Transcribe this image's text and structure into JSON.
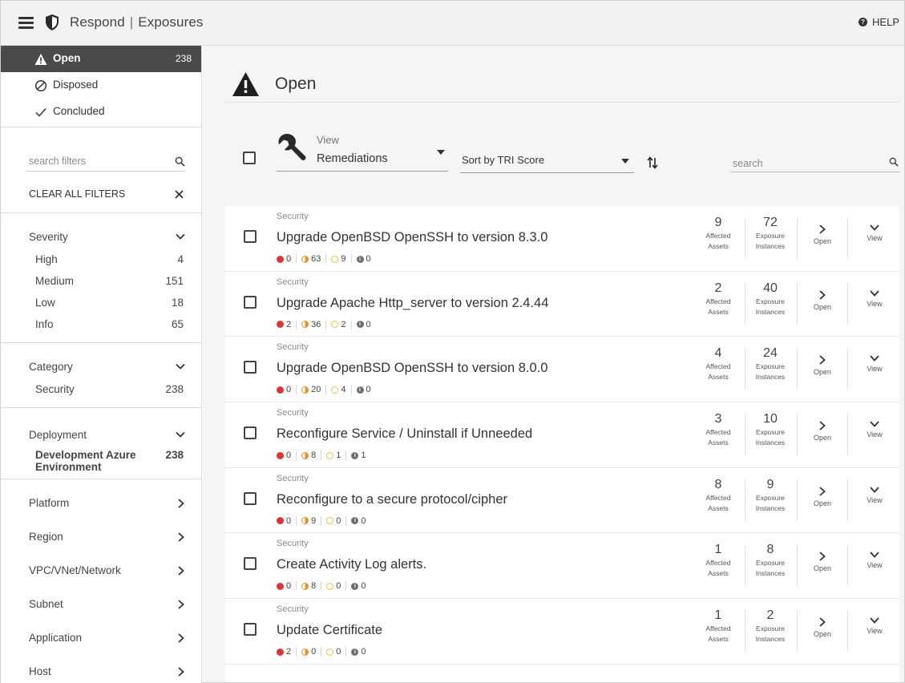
{
  "header": {
    "section": "Respond",
    "separator": "|",
    "page": "Exposures",
    "help_label": "HELP"
  },
  "sidebar": {
    "statuses": [
      {
        "label": "Open",
        "count": "238",
        "icon": "warning-icon",
        "active": true
      },
      {
        "label": "Disposed",
        "count": "",
        "icon": "disposed-icon",
        "active": false
      },
      {
        "label": "Concluded",
        "count": "",
        "icon": "check-icon",
        "active": false
      }
    ],
    "search_placeholder": "search filters",
    "clear_all_label": "CLEAR ALL FILTERS",
    "severity": {
      "label": "Severity",
      "items": [
        {
          "label": "High",
          "count": "4"
        },
        {
          "label": "Medium",
          "count": "151"
        },
        {
          "label": "Low",
          "count": "18"
        },
        {
          "label": "Info",
          "count": "65"
        }
      ]
    },
    "category": {
      "label": "Category",
      "items": [
        {
          "label": "Security",
          "count": "238"
        }
      ]
    },
    "deployment": {
      "label": "Deployment",
      "items": [
        {
          "label": "Development Azure Environment",
          "count": "238"
        }
      ]
    },
    "collapsed_facets": [
      "Platform",
      "Region",
      "VPC/VNet/Network",
      "Subnet",
      "Application",
      "Host"
    ]
  },
  "main": {
    "title": "Open",
    "view_label": "View",
    "view_value": "Remediations",
    "sort_value": "Sort by TRI Score",
    "search_placeholder": "search",
    "affected_label_1": "Affected",
    "affected_label_2": "Assets",
    "exposure_label_1": "Exposure",
    "exposure_label_2": "Instances",
    "open_label": "Open",
    "view_action_label": "View",
    "rows": [
      {
        "category": "Security",
        "title": "Upgrade OpenBSD OpenSSH to version 8.3.0",
        "critical": "0",
        "medium": "63",
        "low": "9",
        "info": "0",
        "assets": "9",
        "instances": "72"
      },
      {
        "category": "Security",
        "title": "Upgrade Apache Http_server to version 2.4.44",
        "critical": "2",
        "medium": "36",
        "low": "2",
        "info": "0",
        "assets": "2",
        "instances": "40"
      },
      {
        "category": "Security",
        "title": "Upgrade OpenBSD OpenSSH to version 8.0.0",
        "critical": "0",
        "medium": "20",
        "low": "4",
        "info": "0",
        "assets": "4",
        "instances": "24"
      },
      {
        "category": "Security",
        "title": "Reconfigure Service / Uninstall if Unneeded",
        "critical": "0",
        "medium": "8",
        "low": "1",
        "info": "1",
        "assets": "3",
        "instances": "10"
      },
      {
        "category": "Security",
        "title": "Reconfigure to a secure protocol/cipher",
        "critical": "0",
        "medium": "9",
        "low": "0",
        "info": "0",
        "assets": "8",
        "instances": "9"
      },
      {
        "category": "Security",
        "title": "Create Activity Log alerts.",
        "critical": "0",
        "medium": "8",
        "low": "0",
        "info": "0",
        "assets": "1",
        "instances": "8"
      },
      {
        "category": "Security",
        "title": "Update Certificate",
        "critical": "2",
        "medium": "0",
        "low": "0",
        "info": "0",
        "assets": "1",
        "instances": "2"
      }
    ]
  },
  "colors": {
    "critical": "#e03333",
    "medium": "#e8922f",
    "low": "#f2c23a",
    "info": "#6e6e6e",
    "active_status_bg": "#4a4a4a"
  }
}
